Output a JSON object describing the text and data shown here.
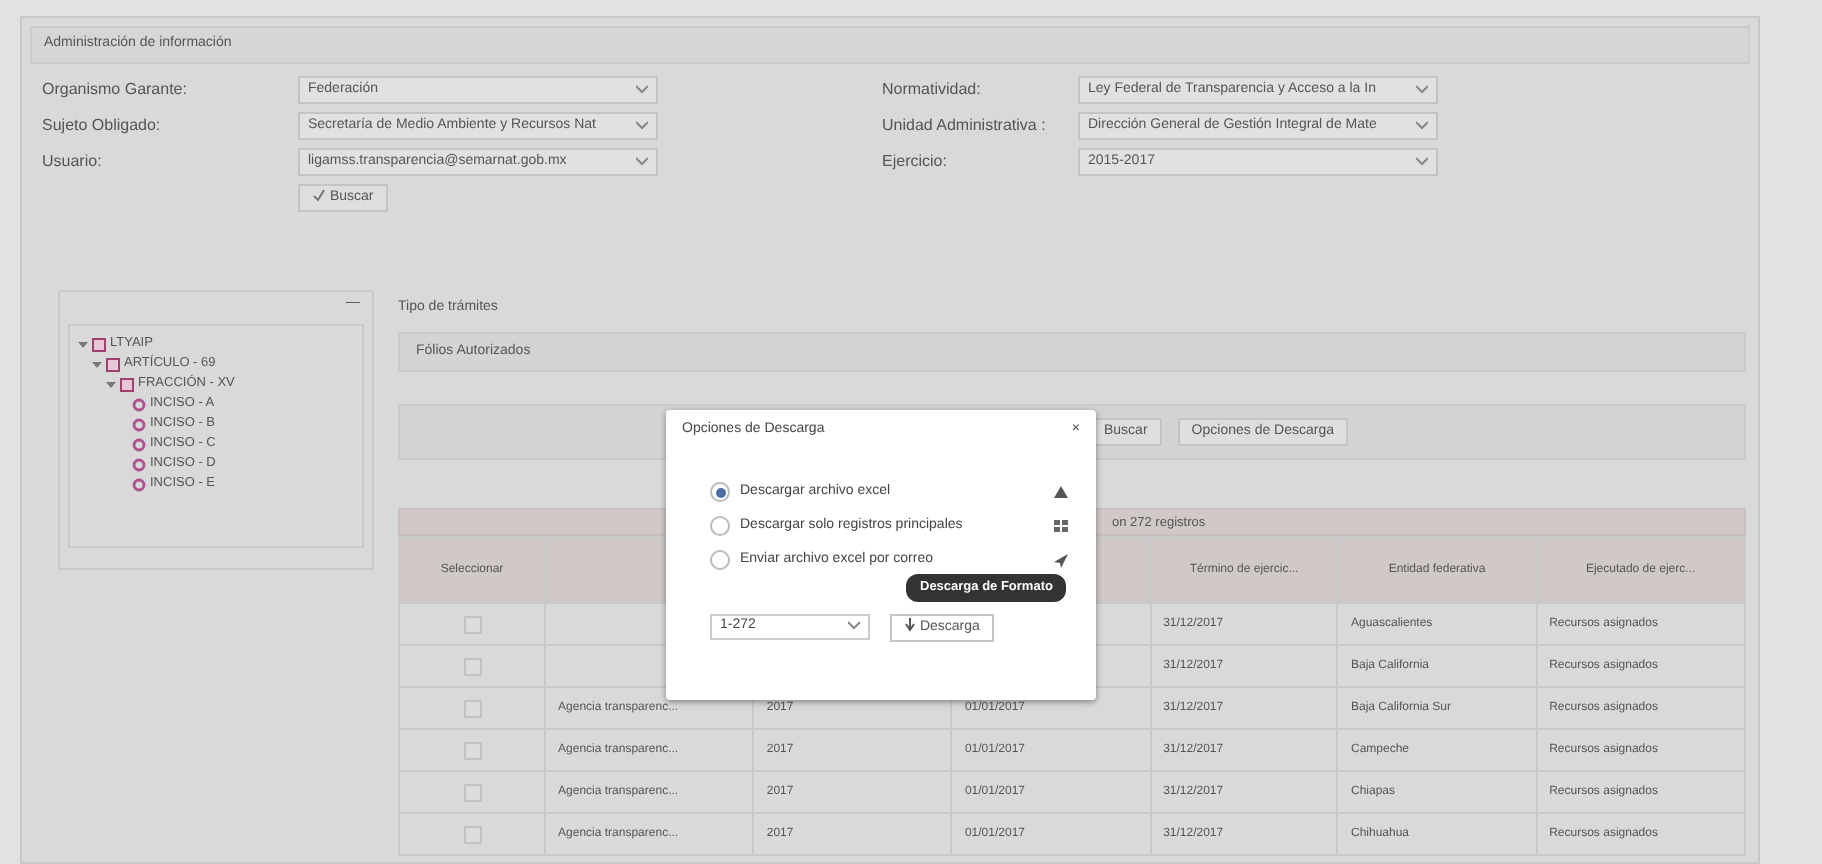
{
  "panel": {
    "title": "Administración de información"
  },
  "filters": [
    {
      "label": "Organismo Garante:",
      "value": "Federación"
    },
    {
      "label": "Normatividad:",
      "value": "Ley Federal de Transparencia y Acceso a la In"
    },
    {
      "label": "Sujeto Obligado:",
      "value": "Secretaría de Medio Ambiente y Recursos Nat"
    },
    {
      "label": "Unidad Administrativa :",
      "value": "Dirección General de Gestión Integral de Mate"
    },
    {
      "label": "Usuario:",
      "value": "ligamss.transparencia@semarnat.gob.mx"
    },
    {
      "label": "Ejercicio:",
      "value": "2015-2017"
    }
  ],
  "search_button": "Buscar",
  "tree": {
    "collapse": "—",
    "items": [
      {
        "label": "LTYAIP",
        "expanded": true,
        "children": [
          {
            "label": "ARTÍCULO - 69",
            "expanded": true,
            "children": [
              {
                "label": "FRACCIÓN - XV",
                "expanded": true,
                "children": [
                  {
                    "label": "INCISO - A"
                  },
                  {
                    "label": "INCISO - B"
                  },
                  {
                    "label": "INCISO - C"
                  },
                  {
                    "label": "INCISO - D"
                  },
                  {
                    "label": "INCISO - E"
                  }
                ]
              }
            ]
          }
        ]
      }
    ]
  },
  "records": {
    "section_title": "Tipo de trámites",
    "type_value": "Fólios Autorizados",
    "toolbar": [
      "Buscar",
      "Opciones de Descarga"
    ],
    "caption": "on 272 registros",
    "columns": [
      "Seleccionar",
      null,
      null,
      null,
      "Término de ejercic...",
      "Entidad federativa",
      "Ejecutado de ejerc..."
    ],
    "rows": [
      {
        "checked": false,
        "cells": [
          null,
          null,
          null,
          null,
          "31/12/2017",
          "Aguascalientes",
          "Recursos asignados"
        ]
      },
      {
        "checked": false,
        "cells": [
          null,
          null,
          null,
          null,
          "31/12/2017",
          "Baja California",
          "Recursos asignados"
        ]
      },
      {
        "checked": false,
        "cells": [
          null,
          "Agencia transparenc...",
          "2017",
          "01/01/2017",
          "31/12/2017",
          "Baja California Sur",
          "Recursos asignados"
        ]
      },
      {
        "checked": false,
        "cells": [
          null,
          "Agencia transparenc...",
          "2017",
          "01/01/2017",
          "31/12/2017",
          "Campeche",
          "Recursos asignados"
        ]
      },
      {
        "checked": false,
        "cells": [
          null,
          "Agencia transparenc...",
          "2017",
          "01/01/2017",
          "31/12/2017",
          "Chiapas",
          "Recursos asignados"
        ]
      },
      {
        "checked": false,
        "cells": [
          null,
          "Agencia transparenc...",
          "2017",
          "01/01/2017",
          "31/12/2017",
          "Chihuahua",
          "Recursos asignados"
        ]
      }
    ]
  },
  "dialog": {
    "title": "Opciones de Descarga",
    "close": "×",
    "options": [
      {
        "label": "Descargar archivo excel",
        "selected": true,
        "kind": "download"
      },
      {
        "label": "Descargar solo registros principales",
        "selected": false,
        "kind": "grid"
      },
      {
        "label": "Enviar archivo excel por correo",
        "selected": false,
        "kind": "send"
      }
    ],
    "range": "1-272",
    "download_button": "Descarga",
    "tooltip": "Descarga de Formato"
  }
}
